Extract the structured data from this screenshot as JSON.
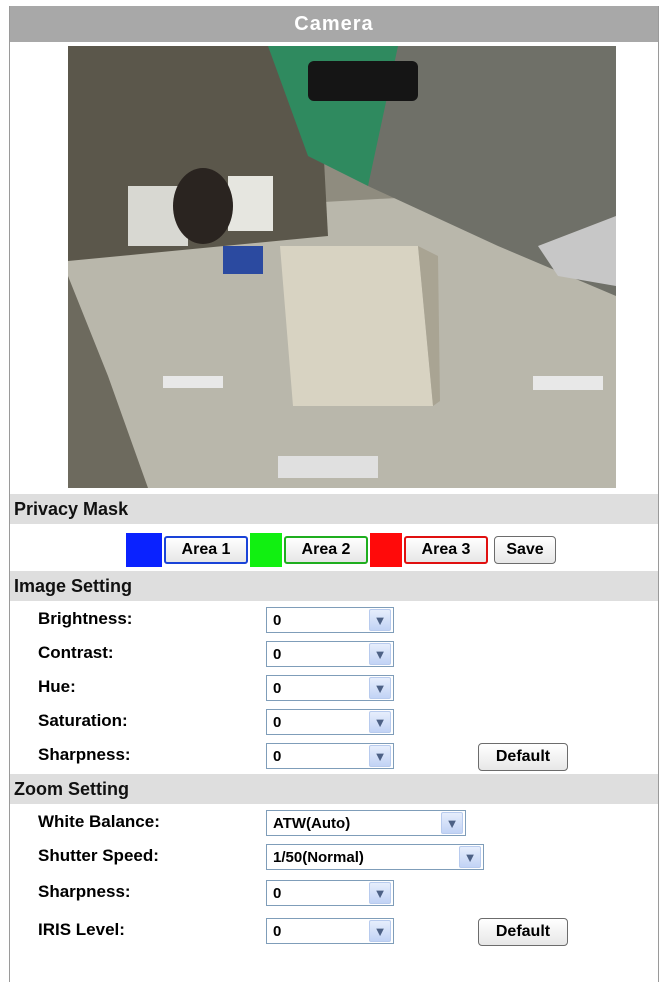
{
  "title": "Camera",
  "privacy_mask": {
    "heading": "Privacy Mask",
    "areas": [
      {
        "label": "Area 1",
        "color": "#0a22ff"
      },
      {
        "label": "Area 2",
        "color": "#11f011"
      },
      {
        "label": "Area 3",
        "color": "#ff0a0a"
      }
    ],
    "save_label": "Save"
  },
  "image_setting": {
    "heading": "Image Setting",
    "rows": [
      {
        "label": "Brightness:",
        "value": "0"
      },
      {
        "label": "Contrast:",
        "value": "0"
      },
      {
        "label": "Hue:",
        "value": "0"
      },
      {
        "label": "Saturation:",
        "value": "0"
      },
      {
        "label": "Sharpness:",
        "value": "0"
      }
    ],
    "default_label": "Default"
  },
  "zoom_setting": {
    "heading": "Zoom Setting",
    "rows": [
      {
        "label": "White Balance:",
        "value": "ATW(Auto)"
      },
      {
        "label": "Shutter Speed:",
        "value": "1/50(Normal)"
      },
      {
        "label": "Sharpness:",
        "value": "0"
      },
      {
        "label": "IRIS Level:",
        "value": "0"
      }
    ],
    "default_label": "Default"
  },
  "icons": {
    "dropdown": "chevron-down-icon"
  },
  "colors": {
    "title_bar": "#a8a8a8",
    "section_bar": "#dedede"
  }
}
